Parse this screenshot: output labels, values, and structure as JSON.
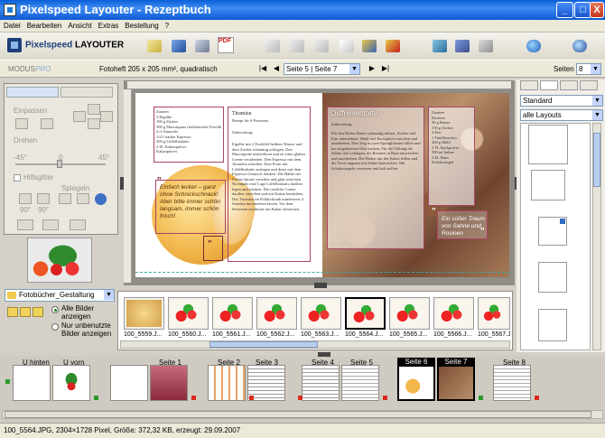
{
  "window": {
    "title": "Pixelspeed Layouter - Rezeptbuch",
    "buttons": {
      "minimize": "_",
      "maximize": "□",
      "close": "X"
    }
  },
  "menu": [
    "Datei",
    "Bearbeiten",
    "Ansicht",
    "Extras",
    "Bestellung",
    "?"
  ],
  "toolbar": {
    "brand_prefix": "Pixelspeed",
    "brand_name": "LAYOUTER",
    "pdf_label": "PDF"
  },
  "navbar": {
    "modus_label": "MODUS:",
    "modus_value": "PRO",
    "format": "Fotoheft 205 x 205 mm², quadratisch",
    "page_select": "Seite 5 | Seite 7",
    "seiten_label": "Seiten",
    "seiten_value": "8"
  },
  "left_panel": {
    "einpassen": "Einpassen",
    "drehen": "Drehen",
    "angle_left": "-45°",
    "angle_mid": "0",
    "angle_right": "45°",
    "hilfsgitter": "Hilfsgitter",
    "spiegeln": "Spiegeln",
    "rot_a": "90°",
    "rot_b": "90°"
  },
  "folder": {
    "name": "Fotobücher_Gestaltung",
    "option_all": "Alle Bilder anzeigen",
    "option_unused": "Nur unbenutzte Bilder anzeigen"
  },
  "photos": [
    {
      "label": "100_5559.J..."
    },
    {
      "label": "100_5560.J..."
    },
    {
      "label": "100_5561.J..."
    },
    {
      "label": "100_5562.J..."
    },
    {
      "label": "100_5563.J..."
    },
    {
      "label": "100_5564.J..."
    },
    {
      "label": "100_5565.J..."
    },
    {
      "label": "100_5566.J..."
    },
    {
      "label": "100_5567.J..."
    }
  ],
  "right_panel": {
    "style_select": "Standard",
    "layout_select": "alle Layouts"
  },
  "pages": [
    {
      "label": "U hinten"
    },
    {
      "label": "U vorn"
    },
    {
      "label": "Seite 1"
    },
    {
      "label": "Seite 2"
    },
    {
      "label": "Seite 3"
    },
    {
      "label": "Seite 4"
    },
    {
      "label": "Seite 5"
    },
    {
      "label": "Seite 6"
    },
    {
      "label": "Seite 7"
    },
    {
      "label": "Seite 8"
    }
  ],
  "spread": {
    "left_heading": "Tiramisu",
    "left_sub": "Rezept für 6 Personen",
    "left_zutaten": "Zutaten",
    "left_zubereitung": "Zubereitung:",
    "left_ing": "3 Eigelbe\n100 g Zucker\n500 g Mascarpone (italienischer Frischkäse)\n4 cl Amaretto\n1/4 l starker Espresso\n200 g Löffelbiskuits\n2 EL Kakaopulver\nKakaopulver",
    "left_body": "Eigelbe mit 2 Esslöffel heißem Wasser und dem Zucker schaumig schlagen. Den Mascarpone unterrühren und zu einer glatten Creme verarbeiten. Den Espresso mit dem Amaretto mischen. Eine Form mit Löffelbiskuits auslegen und diese mit dem Espresso-Gemisch tränken. Die Hälfte der Creme darauf verteilen und glatt streichen. Nochmals eine Lage Löffelbiskuits darüber legen und tränken. Die restliche Creme darüber streichen und mit Kakao bestäuben. Das Tiramisu im Kühlschrank mindestens 4 Stunden durchziehen lassen. Vor dem Servieren nochmals mit Kakao bestreuen.",
    "left_quote": "Einfach lecker – ganz ohne Schnickschnack! Aber bitte immer schön langsam, immer schön frisch!",
    "right_heading": "Ostfriesentorte",
    "right_zubereitung": "Zubereitung:",
    "right_body": "Für den Boden Butter schaumig rühren, Zucker und Eier unterrühren. Mehl und Backpulver mischen und unterheben. Den Teig in zwei Springformen füllen und im vorgeheizten Ofen backen. Für die Füllung die Sahne steif schlagen, die Rosinen in Rum einweichen und unterheben. Die Böden mit der Sahne füllen und die Torte ringsum mit Sahne bestreichen. Mit Schokoraspeln verzieren und kalt stellen.",
    "right_zutaten": "Zutaten",
    "right_ing": "Rosinen\n50 g Butter\n150 g Zucker\n4 Eier\n1 Vanillezucker\n200 g Mehl\n2 TL Backpulver\n500 ml Sahne\n3 EL Rum\nSchokoraspel",
    "right_quote": "Ein süßer Traum von Sahne und Rosinen"
  },
  "status": "100_5564.JPG, 2304×1728 Pixel, Größe: 372,32 KB, erzeugt: 29.09.2007",
  "colors": {
    "titlebar": "#0a5fd8",
    "accent": "#316ac5",
    "page_bg": "#8f8d86",
    "selection": "#000000"
  }
}
